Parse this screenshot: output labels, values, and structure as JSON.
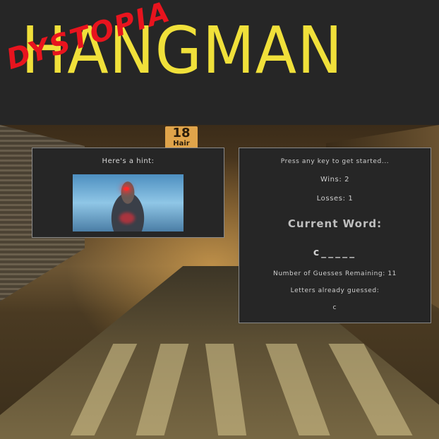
{
  "header": {
    "title": "HANGMAN",
    "subtitle": "DYSTOPIA",
    "title_color": "#f0e03a",
    "subtitle_color": "#e8141e"
  },
  "background": {
    "street_sign": "18",
    "street_sign_sub": "Hair"
  },
  "hint": {
    "label": "Here's a hint:"
  },
  "game": {
    "start_prompt": "Press any key to get started...",
    "wins_text": "Wins: 2",
    "wins": 2,
    "losses_text": "Losses: 1",
    "losses": 1,
    "current_word_label": "Current Word:",
    "current_word": "c_____",
    "guesses_remaining_text": "Number of Guesses Remaining: 11",
    "guesses_remaining": 11,
    "letters_guessed_label": "Letters already guessed:",
    "letters_guessed": "c"
  }
}
